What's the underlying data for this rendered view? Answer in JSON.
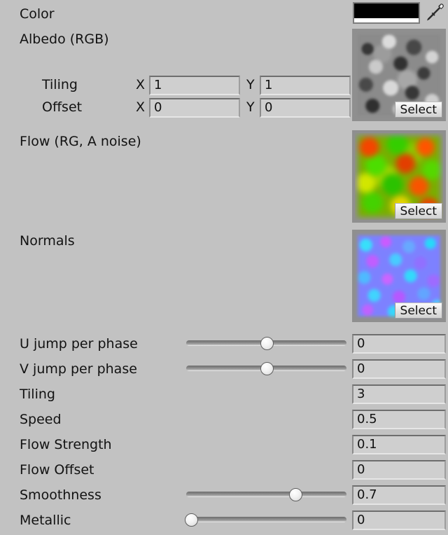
{
  "inspector": {
    "background_color": "#c2c2c2",
    "rows": {
      "color": {
        "label": "Color",
        "swatch_color": "#000000",
        "alpha_color": "#ffffff"
      },
      "albedo": {
        "label": "Albedo (RGB)",
        "select_label": "Select",
        "texture": "grayscale-noise"
      },
      "tiling": {
        "label": "Tiling",
        "x_axis": "X",
        "y_axis": "Y",
        "x_value": "1",
        "y_value": "1"
      },
      "offset": {
        "label": "Offset",
        "x_axis": "X",
        "y_axis": "Y",
        "x_value": "0",
        "y_value": "0"
      },
      "flow": {
        "label": "Flow (RG, A noise)",
        "select_label": "Select",
        "texture": "flow-map-red-green"
      },
      "normals": {
        "label": "Normals",
        "select_label": "Select",
        "texture": "normal-map-blue-purple"
      }
    },
    "properties": [
      {
        "label": "U jump per phase",
        "value": "0",
        "has_slider": true,
        "slider_percent": 50
      },
      {
        "label": "V jump per phase",
        "value": "0",
        "has_slider": true,
        "slider_percent": 50
      },
      {
        "label": "Tiling",
        "value": "3",
        "has_slider": false,
        "slider_percent": 0
      },
      {
        "label": "Speed",
        "value": "0.5",
        "has_slider": false,
        "slider_percent": 0
      },
      {
        "label": "Flow Strength",
        "value": "0.1",
        "has_slider": false,
        "slider_percent": 0
      },
      {
        "label": "Flow Offset",
        "value": "0",
        "has_slider": false,
        "slider_percent": 0
      },
      {
        "label": "Smoothness",
        "value": "0.7",
        "has_slider": true,
        "slider_percent": 68
      },
      {
        "label": "Metallic",
        "value": "0",
        "has_slider": true,
        "slider_percent": 3
      }
    ],
    "icons": {
      "eyedropper": "eyedropper-icon"
    }
  }
}
